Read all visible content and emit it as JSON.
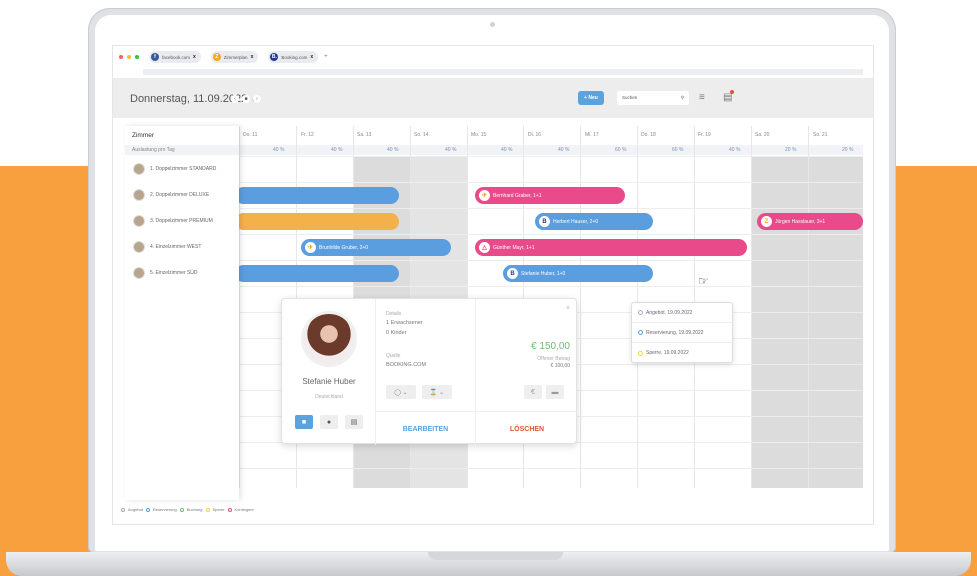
{
  "browser": {
    "tabs": [
      {
        "label": "facebook.com",
        "icon": "facebook-icon",
        "letter": "f",
        "color": "#3b5998"
      },
      {
        "label": "Zimmerplan",
        "icon": "zimmerplan-icon",
        "letter": "Z",
        "color": "#f5a623"
      },
      {
        "label": "Booking.com",
        "icon": "booking-icon",
        "letter": "B.",
        "color": "#243b8f"
      }
    ],
    "close_glyph": "x",
    "new_tab_glyph": "+"
  },
  "header": {
    "date": "Donnerstag, 11.09.2022 ⌄",
    "nav_prev": "‹",
    "nav_today": "■",
    "nav_next": "›",
    "new_button": "+ Neu",
    "search_placeholder": "Suchen",
    "search_icon": "search-icon",
    "filter_icon": "sliders-icon",
    "notes_icon": "notes-icon"
  },
  "rooms_panel": {
    "title": "Zimmer",
    "subtitle": "Auslastung pro Tag",
    "rooms": [
      "1. Doppelzimmer STANDARD",
      "2. Doppelzimmer DELUXE",
      "3. Doppelzimmer PREMIUM",
      "4. Einzelzimmer WEST",
      "5. Einzelzimmer SÜD"
    ]
  },
  "days": [
    {
      "label": "Do. 11",
      "pct": "40 %"
    },
    {
      "label": "Fr. 12",
      "pct": "40 %"
    },
    {
      "label": "Sa. 13",
      "pct": "40 %"
    },
    {
      "label": "So. 14",
      "pct": "40 %"
    },
    {
      "label": "Mo. 15",
      "pct": "40 %"
    },
    {
      "label": "Di. 16",
      "pct": "40 %"
    },
    {
      "label": "Mi. 17",
      "pct": "60 %"
    },
    {
      "label": "Do. 18",
      "pct": "60 %"
    },
    {
      "label": "Fr. 19",
      "pct": "40 %"
    },
    {
      "label": "Sa. 20",
      "pct": "20 %"
    },
    {
      "label": "So. 21",
      "pct": "20 %"
    }
  ],
  "bookings": [
    {
      "label": "Bernhard Graber, 1+1",
      "color": "#e94b8a",
      "source": "airline"
    },
    {
      "label": "Herbert Hauser, 2+0",
      "color": "#5b9ee0",
      "source": "booking"
    },
    {
      "label": "Jürgen Hasslauer, 3+1",
      "color": "#e94b8a",
      "source": "zimmerplan"
    },
    {
      "label": "Brunhilde Gruber, 2+0",
      "color": "#5b9ee0",
      "source": "airline"
    },
    {
      "label": "Günther Mayr, 1+1",
      "color": "#e94b8a",
      "source": "airbnb"
    },
    {
      "label": "Stefanie Huber, 1+0",
      "color": "#5b9ee0",
      "source": "booking"
    },
    {
      "label": "",
      "color": "#5b9ee0"
    },
    {
      "label": "",
      "color": "#f4b04a"
    },
    {
      "label": "",
      "color": "#5b9ee0"
    }
  ],
  "popup": {
    "name": "Stefanie Huber",
    "country": "Deutschland",
    "details_label": "Details",
    "adults": "1 Erwachsener",
    "children": "0 Kinder",
    "source_label": "Quelle",
    "source": "BOOKING.COM",
    "amount": "€ 150,00",
    "open_label": "Offener Betrag",
    "open_amount": "€ 100,00",
    "edit": "BEARBEITEN",
    "delete": "LÖSCHEN",
    "close": "×",
    "status_select": "◯ ⌄",
    "time_select": "⌛ ⌄"
  },
  "context_menu": {
    "items": [
      {
        "label": "Angebot, 19.09.2022",
        "color": "#9fb3d1"
      },
      {
        "label": "Reservierung, 19.09.2022",
        "color": "#5b9ee0"
      },
      {
        "label": "Sperre, 19.09.2022",
        "color": "#f4d24a"
      }
    ]
  },
  "legend": [
    {
      "label": "Angebot",
      "color": "#aaa"
    },
    {
      "label": "Reservierung",
      "color": "#5b9ee0"
    },
    {
      "label": "Buchung",
      "color": "#6bbf6b"
    },
    {
      "label": "Sperre",
      "color": "#f4d24a"
    },
    {
      "label": "Kontingent",
      "color": "#e94b8a"
    }
  ]
}
